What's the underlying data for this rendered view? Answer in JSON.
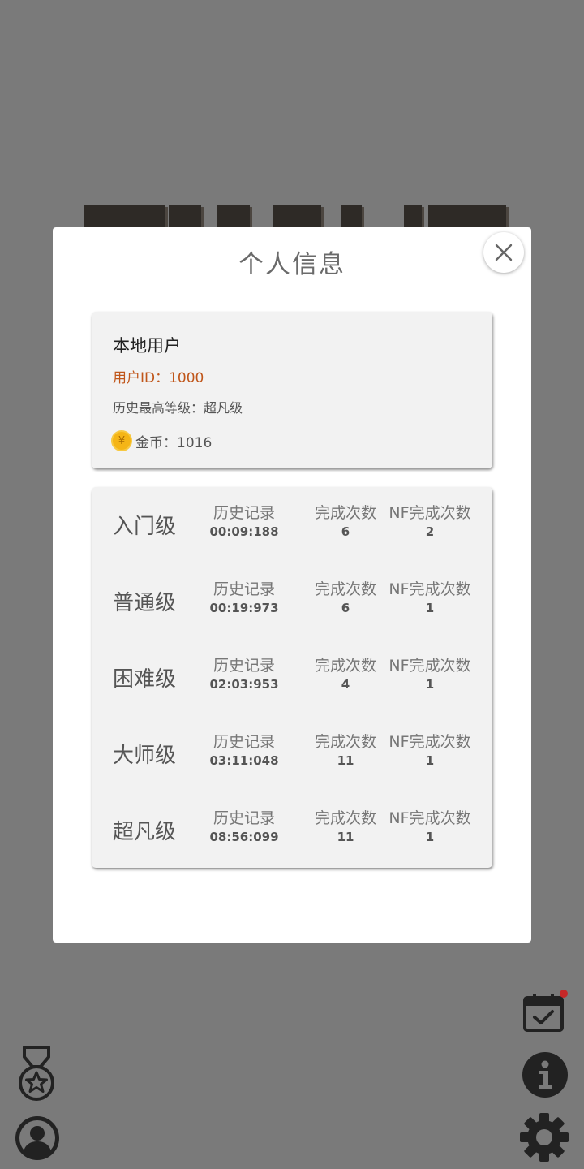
{
  "modal": {
    "title": "个人信息"
  },
  "user": {
    "name": "本地用户",
    "id_text": "用户ID：1000",
    "highest_level_text": "历史最高等级：超凡级",
    "coin_symbol": "¥",
    "coins_text": "金币：1016"
  },
  "stats": {
    "col_labels": {
      "record": "历史记录",
      "completions": "完成次数",
      "nf_completions": "NF完成次数"
    },
    "rows": [
      {
        "level": "入门级",
        "record": "00:09:188",
        "completions": "6",
        "nf_completions": "2"
      },
      {
        "level": "普通级",
        "record": "00:19:973",
        "completions": "6",
        "nf_completions": "1"
      },
      {
        "level": "困难级",
        "record": "02:03:953",
        "completions": "4",
        "nf_completions": "1"
      },
      {
        "level": "大师级",
        "record": "03:11:048",
        "completions": "11",
        "nf_completions": "1"
      },
      {
        "level": "超凡级",
        "record": "08:56:099",
        "completions": "11",
        "nf_completions": "1"
      }
    ]
  },
  "icons": {
    "close": "close-icon",
    "medal": "medal-icon",
    "profile": "profile-icon",
    "calendar": "calendar-check-icon",
    "info": "info-icon",
    "settings": "gear-icon"
  },
  "colors": {
    "backdrop": "#7a7a7a",
    "accent_id": "#c0561a",
    "coin": "#f5b516",
    "notification": "#c62828"
  }
}
